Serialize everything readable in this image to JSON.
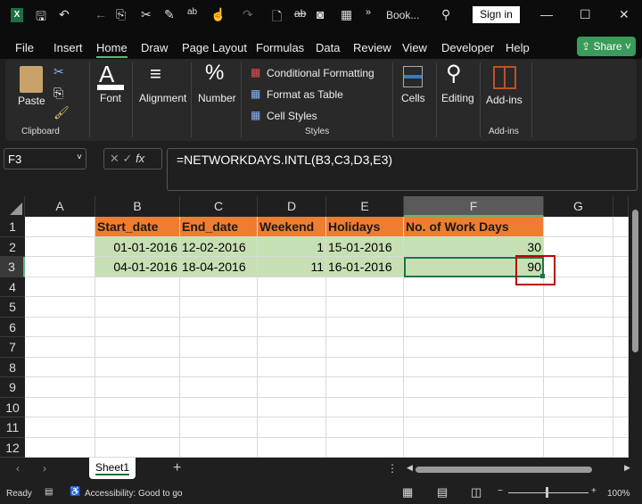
{
  "titlebar": {
    "file_name": "Book...",
    "sign_in": "Sign in",
    "app_icon": "excel-icon"
  },
  "menu": [
    "File",
    "Insert",
    "Home",
    "Draw",
    "Page Layout",
    "Formulas",
    "Data",
    "Review",
    "View",
    "Developer",
    "Help"
  ],
  "share": "Share",
  "ribbon": {
    "paste": "Paste",
    "clipboard": "Clipboard",
    "font": "Font",
    "alignment": "Alignment",
    "number": "Number",
    "conditional_formatting": "Conditional Formatting",
    "format_as_table": "Format as Table",
    "cell_styles": "Cell Styles",
    "styles": "Styles",
    "cells": "Cells",
    "editing": "Editing",
    "addins": "Add-ins",
    "addins_group": "Add-ins"
  },
  "formula_bar": {
    "name_box": "F3",
    "fx": "fx",
    "formula": "=NETWORKDAYS.INTL(B3,C3,D3,E3)"
  },
  "columns": [
    "A",
    "B",
    "C",
    "D",
    "E",
    "F",
    "G"
  ],
  "rows": [
    "1",
    "2",
    "3",
    "4",
    "5",
    "6",
    "7",
    "8",
    "9",
    "10",
    "11",
    "12"
  ],
  "table": {
    "headers": [
      "Start_date",
      "End_date",
      "Weekend",
      "Holidays",
      "No. of Work Days"
    ],
    "rows": [
      [
        "01-01-2016",
        "12-02-2016",
        "1",
        "15-01-2016",
        "30"
      ],
      [
        "04-01-2016",
        "18-04-2016",
        "11",
        "16-01-2016",
        "90"
      ]
    ]
  },
  "colors": {
    "header_fill": "#ed7d31",
    "data_fill": "#c6e0b4",
    "highlight": "#c00000"
  },
  "sheet_tab": "Sheet1",
  "status": {
    "ready": "Ready",
    "accessibility": "Accessibility: Good to go",
    "zoom": "100%"
  }
}
